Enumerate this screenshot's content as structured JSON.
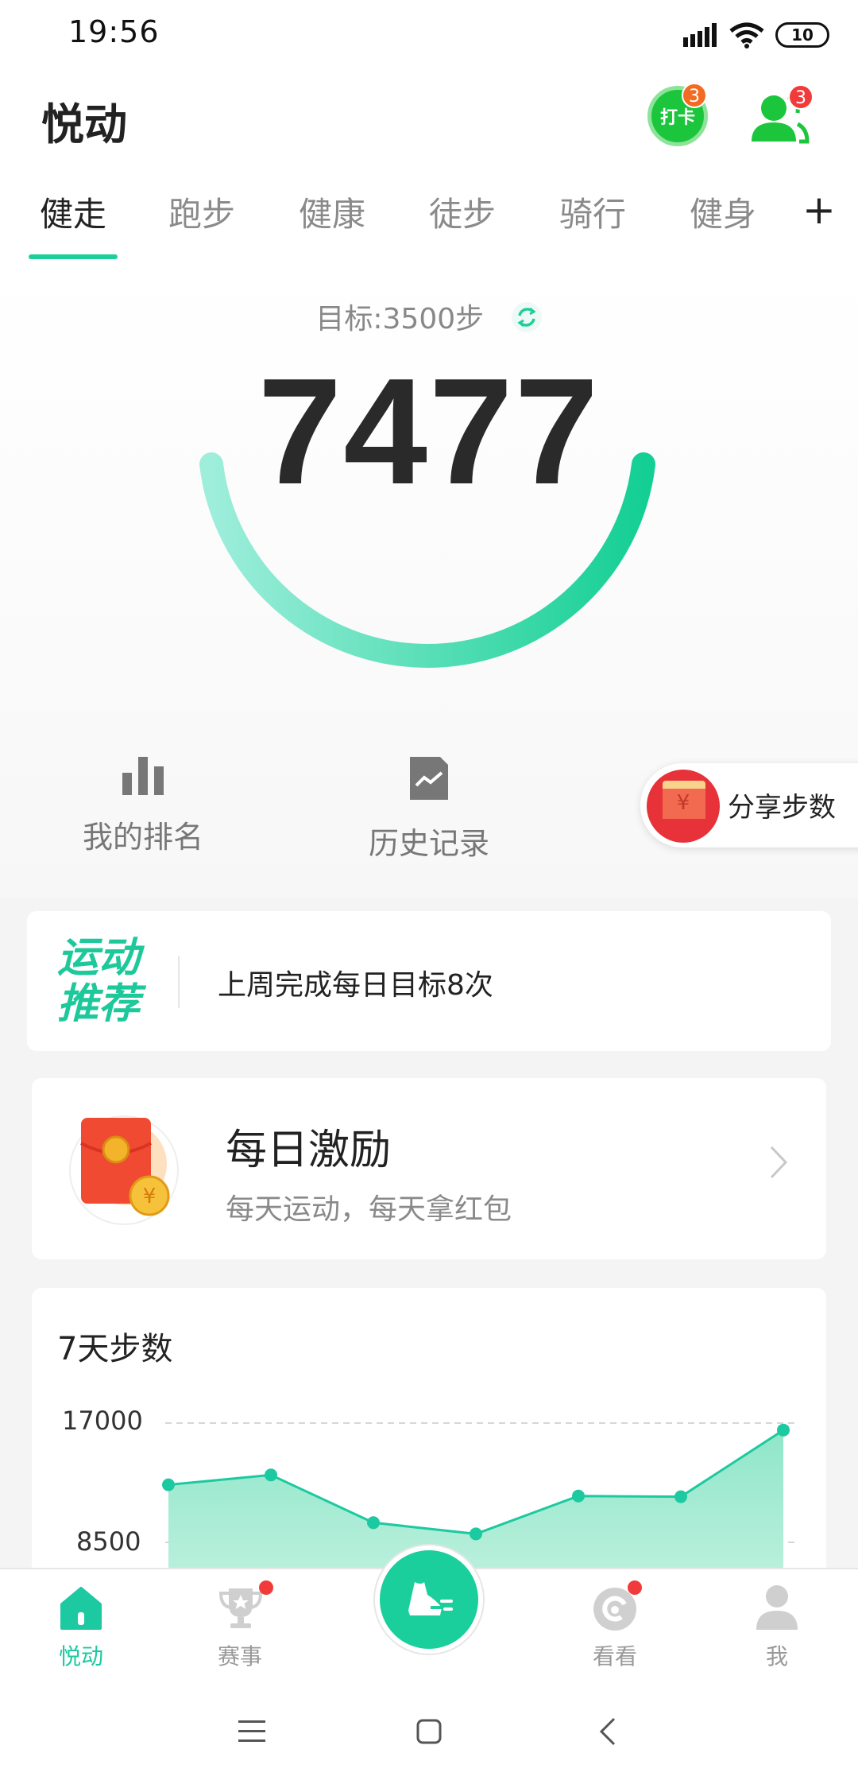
{
  "status_bar": {
    "time": "19:56",
    "battery": "10"
  },
  "header": {
    "title": "悦动",
    "punch_label": "打卡",
    "punch_badge": "3",
    "friends_badge": "3"
  },
  "tabs": [
    {
      "label": "健走",
      "active": true
    },
    {
      "label": "跑步"
    },
    {
      "label": "健康"
    },
    {
      "label": "徒步"
    },
    {
      "label": "骑行"
    },
    {
      "label": "健身"
    }
  ],
  "tab_add": "+",
  "goal": {
    "text": "目标:3500步"
  },
  "steps": {
    "count": "7477",
    "goal": 3500,
    "progress": 1.0
  },
  "quick_actions": {
    "ranking": "我的排名",
    "history": "历史记录",
    "share": "分享步数"
  },
  "recommend": {
    "logo_line1": "运动",
    "logo_line2": "推荐",
    "text": "上周完成每日目标8次"
  },
  "reward": {
    "title": "每日激励",
    "subtitle": "每天运动，每天拿红包"
  },
  "colors": {
    "accent": "#1ccf9a",
    "gauge_start": "#9eeedb",
    "gauge_end": "#14cf94"
  },
  "chart_data": {
    "type": "area",
    "title": "7天步数",
    "yticks": [
      "17000",
      "8500"
    ],
    "ylim": [
      0,
      17000
    ],
    "values": [
      12600,
      13300,
      9900,
      9100,
      11800,
      11750,
      16500
    ]
  },
  "bottom_nav": [
    {
      "label": "悦动",
      "active": true
    },
    {
      "label": "赛事",
      "dot": true
    },
    {
      "label": "看看",
      "dot": true
    },
    {
      "label": "我"
    }
  ]
}
